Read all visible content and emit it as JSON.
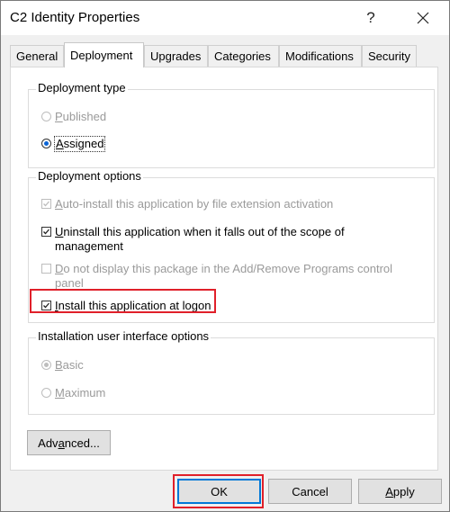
{
  "window": {
    "title": "C2 Identity Properties",
    "help_glyph": "?"
  },
  "tabs": [
    {
      "label": "General",
      "active": false
    },
    {
      "label": "Deployment",
      "active": true
    },
    {
      "label": "Upgrades",
      "active": false
    },
    {
      "label": "Categories",
      "active": false
    },
    {
      "label": "Modifications",
      "active": false
    },
    {
      "label": "Security",
      "active": false
    }
  ],
  "deployment_type": {
    "legend": "Deployment type",
    "published": {
      "label_rest": "ublished",
      "accel": "P",
      "checked": false,
      "enabled": false
    },
    "assigned": {
      "label_rest": "ssigned",
      "accel": "A",
      "checked": true,
      "enabled": true
    }
  },
  "deployment_options": {
    "legend": "Deployment options",
    "auto_install": {
      "accel": "A",
      "label_rest": "uto-install this application by file extension activation",
      "checked": true,
      "enabled": false
    },
    "uninstall": {
      "accel": "U",
      "label_rest": "ninstall this application when it falls out of the scope of",
      "label_line2": "management",
      "checked": true,
      "enabled": true
    },
    "do_not_display": {
      "accel": "D",
      "label_rest": "o not display this package in the Add/Remove Programs control",
      "label_line2": "panel",
      "checked": false,
      "enabled": false
    },
    "install_logon": {
      "accel": "I",
      "label_rest": "nstall this application at logon",
      "checked": true,
      "enabled": true,
      "highlighted": true
    }
  },
  "ui_options": {
    "legend": "Installation user interface options",
    "basic": {
      "accel": "B",
      "label_rest": "asic",
      "checked": true,
      "enabled": false
    },
    "maximum": {
      "accel": "M",
      "label_rest": "aximum",
      "checked": false,
      "enabled": false
    }
  },
  "buttons": {
    "advanced": {
      "pre": "Adv",
      "accel": "a",
      "post": "nced..."
    },
    "ok": "OK",
    "cancel": "Cancel",
    "apply": {
      "accel": "A",
      "rest": "pply"
    }
  },
  "colors": {
    "highlight": "#e0202a",
    "accent": "#0078d7",
    "disabled_text": "#9a9a9a"
  }
}
